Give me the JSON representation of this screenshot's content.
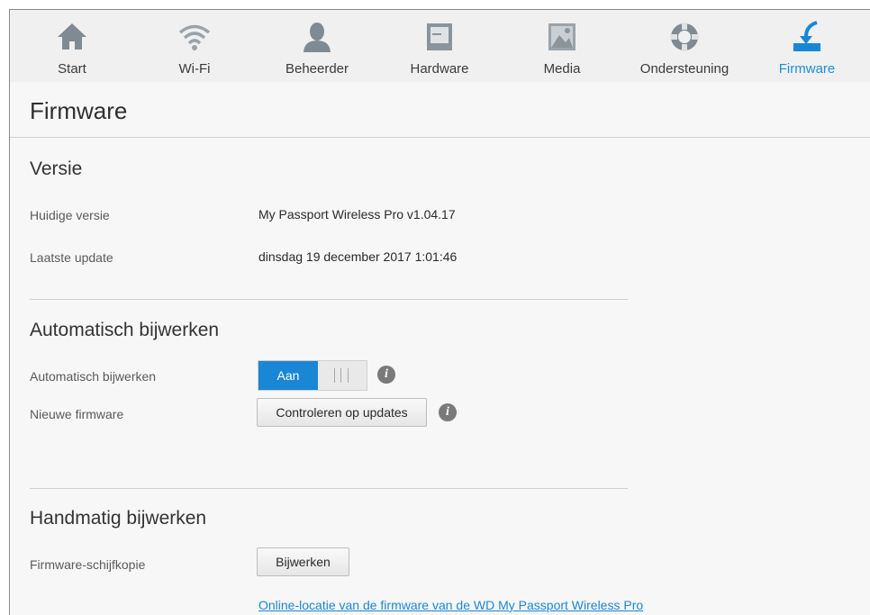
{
  "nav": {
    "items": [
      {
        "label": "Start",
        "icon": "home-icon"
      },
      {
        "label": "Wi-Fi",
        "icon": "wifi-icon"
      },
      {
        "label": "Beheerder",
        "icon": "user-icon"
      },
      {
        "label": "Hardware",
        "icon": "hardware-icon"
      },
      {
        "label": "Media",
        "icon": "media-icon"
      },
      {
        "label": "Ondersteuning",
        "icon": "lifebuoy-icon"
      },
      {
        "label": "Firmware",
        "icon": "firmware-icon"
      }
    ],
    "active": "Firmware",
    "active_color": "#1a8fd8"
  },
  "page": {
    "title": "Firmware"
  },
  "version": {
    "title": "Versie",
    "current_label": "Huidige versie",
    "current_value": "My Passport Wireless Pro v1.04.17",
    "last_update_label": "Laatste update",
    "last_update_value": "dinsdag 19 december 2017 1:01:46"
  },
  "auto_update": {
    "title": "Automatisch bijwerken",
    "toggle_label": "Automatisch bijwerken",
    "toggle_value": "Aan",
    "toggle_on": true,
    "new_fw_label": "Nieuwe firmware",
    "check_button": "Controleren op updates",
    "info_glyph": "i"
  },
  "manual_update": {
    "title": "Handmatig bijwerken",
    "image_label": "Firmware-schijfkopie",
    "update_button": "Bijwerken",
    "online_link": "Online-locatie van de firmware van de WD My Passport Wireless Pro"
  },
  "colors": {
    "accent": "#1a86d6",
    "icon_gray": "#7f8a93"
  }
}
